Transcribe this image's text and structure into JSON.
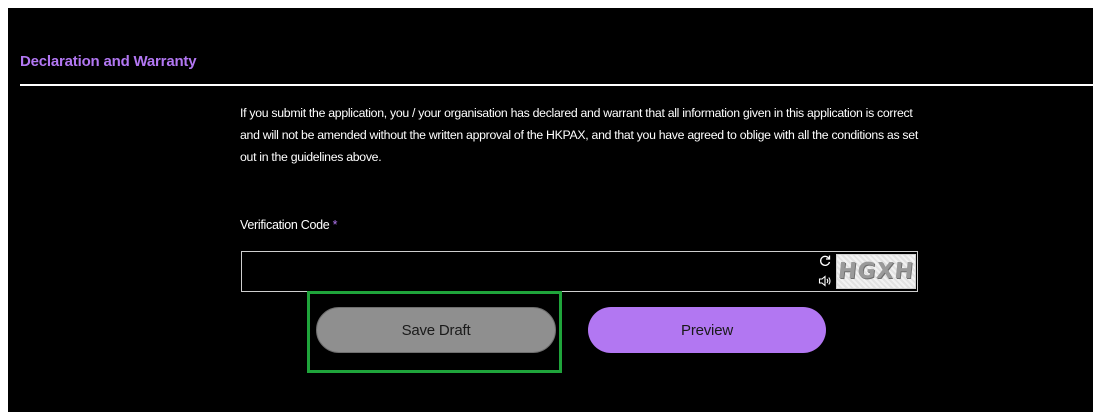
{
  "section": {
    "title": "Declaration and Warranty"
  },
  "declaration": {
    "text": "If you submit the application, you / your organisation has declared and warrant that all information given in this application is correct and will not be amended without the written approval of the HKPAX, and that you have agreed to oblige with all the conditions as set out in the guidelines above."
  },
  "verification": {
    "label": "Verification Code",
    "required_marker": "*",
    "value": "",
    "captcha_text": "HGXH",
    "refresh_icon": "refresh-icon",
    "audio_icon": "speaker-icon"
  },
  "buttons": {
    "save_draft": "Save Draft",
    "preview": "Preview"
  },
  "colors": {
    "accent": "#b277f2",
    "highlight": "#1fa43b",
    "save_button": "#8f8f8f",
    "background": "#000000"
  }
}
